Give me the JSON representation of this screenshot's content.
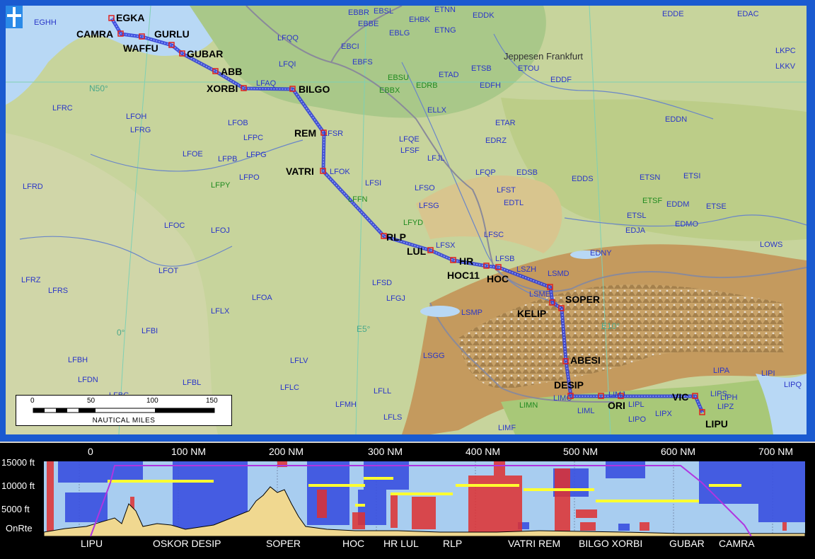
{
  "map": {
    "grid_labels": {
      "lat": "N50°",
      "lon0": "0°",
      "lon5": "E5°",
      "lon10": "E10°"
    },
    "waypoints": [
      "EGKA",
      "CAMRA",
      "GURLU",
      "WAFFU",
      "GUBAR",
      "ABB",
      "XORBI",
      "BILGO",
      "REM",
      "VATRI",
      "RLP",
      "LUL",
      "HR",
      "HOC11",
      "HOC",
      "SOPER",
      "KELIP",
      "ABESI",
      "DESIP",
      "ORI",
      "VIC",
      "LIPU"
    ],
    "airports_blue": [
      "EGHH",
      "EBBR",
      "EBSL",
      "ETNN",
      "EDDK",
      "EDDE",
      "EDAC",
      "EBBE",
      "EHBK",
      "EBLG",
      "ETNG",
      "LFQQ",
      "EBCI",
      "EBFS",
      "LKPC",
      "LFQI",
      "ETAD",
      "ETSB",
      "ETOU",
      "EDDF",
      "LKKV",
      "LFAQ",
      "EDFH",
      "LFRC",
      "ELLX",
      "LFOH",
      "EDDN",
      "LFRG",
      "LFOB",
      "LFSR",
      "ETAR",
      "LFPC",
      "LFQE",
      "EDRZ",
      "LFOE",
      "LFPB",
      "LFPG",
      "LFSF",
      "LFJL",
      "LFOK",
      "LFQP",
      "EDSB",
      "ETSN",
      "ETSI",
      "LFPO",
      "EDDS",
      "LFRD",
      "LFSI",
      "LFSO",
      "LFST",
      "EDTL",
      "EDDM",
      "ETSE",
      "LFSG",
      "ETSL",
      "LFOC",
      "LFOJ",
      "LFSC",
      "EDJA",
      "EDMO",
      "LFSX",
      "EDNY",
      "LOWS",
      "LFSB",
      "LFOT",
      "LSZH",
      "LSMD",
      "LFRZ",
      "LFSD",
      "LFRS",
      "LFOA",
      "LFGJ",
      "LSME",
      "LFLX",
      "LSMP",
      "LFBI",
      "LSGG",
      "LFBH",
      "LFLV",
      "LIPA",
      "LIPI",
      "LFDN",
      "LFBL",
      "LFLC",
      "LFLL",
      "LIPS",
      "LIPH",
      "LIPO",
      "LFBG",
      "LFMH",
      "LIMJ",
      "LIPL",
      "LIPZ",
      "LIMC",
      "LIPX",
      "LIML",
      "LFLS",
      "LIMF",
      "LIPQ"
    ],
    "airports_green": [
      "EBSU",
      "EDRB",
      "EBBX",
      "LFPY",
      "LFFN",
      "LFYD",
      "ETSF",
      "LIMN"
    ],
    "jeppesen_label": "Jeppesen Frankfurt",
    "scale": {
      "ticks": [
        "0",
        "50",
        "100",
        "150"
      ],
      "caption": "NAUTICAL MILES"
    }
  },
  "profile": {
    "nm_labels": [
      "0",
      "100 NM",
      "200 NM",
      "300 NM",
      "400 NM",
      "500 NM",
      "600 NM",
      "700 NM"
    ],
    "alt_labels": [
      "15000 ft",
      "10000 ft",
      "5000 ft",
      "OnRte"
    ],
    "waypoint_labels": [
      "LIPU",
      "OSKOR DESIP",
      "SOPER",
      "HOC",
      "HR LUL",
      "RLP",
      "VATRI REM",
      "BILGO XORBI",
      "GUBAR",
      "CAMRA"
    ]
  },
  "colors": {
    "frame": "#1a5ad0",
    "route": "#2a3ad8",
    "airport_text": "#2a36c8",
    "altitude_line": "#b035e0",
    "wx_red": "#e03030",
    "wx_blue": "#3046d8"
  }
}
